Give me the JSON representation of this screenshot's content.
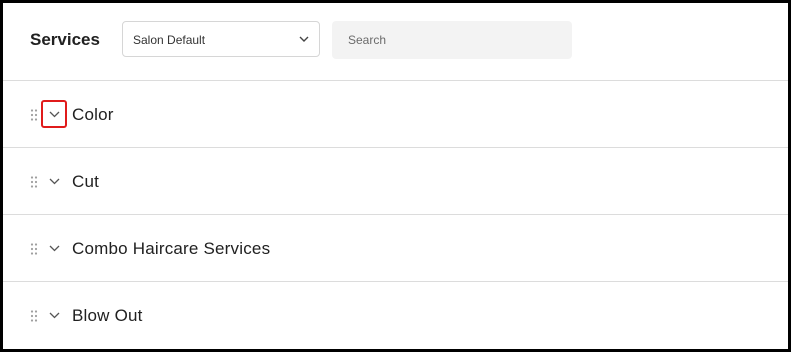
{
  "header": {
    "title": "Services",
    "select": {
      "value": "Salon Default",
      "icon": "chevron-down-icon"
    },
    "search": {
      "placeholder": "Search"
    }
  },
  "categories": [
    {
      "label": "Color",
      "expanded": false,
      "focused": true
    },
    {
      "label": "Cut",
      "expanded": false,
      "focused": false
    },
    {
      "label": "Combo Haircare Services",
      "expanded": false,
      "focused": false
    },
    {
      "label": "Blow Out",
      "expanded": false,
      "focused": false
    }
  ],
  "colors": {
    "focus_ring": "#e01b1b",
    "divider": "#dcdcdc",
    "search_bg": "#f3f3f3"
  }
}
